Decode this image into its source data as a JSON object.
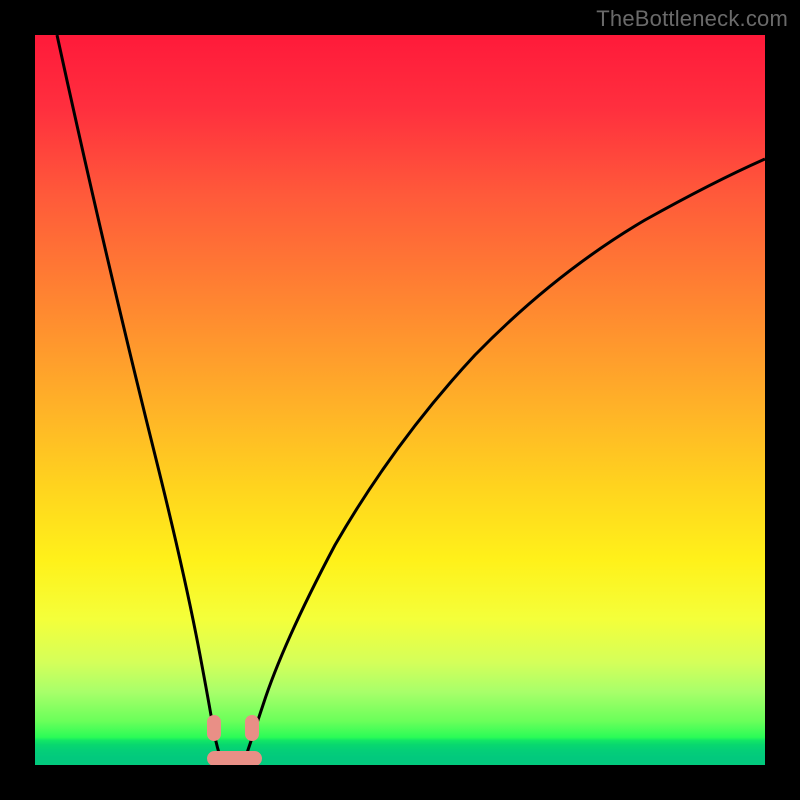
{
  "watermark": {
    "text": "TheBottleneck.com"
  },
  "chart_data": {
    "type": "line",
    "title": "",
    "xlabel": "",
    "ylabel": "",
    "xlim": [
      0,
      100
    ],
    "ylim": [
      0,
      100
    ],
    "grid": false,
    "legend": false,
    "series": [
      {
        "name": "curve",
        "x": [
          2,
          5,
          10,
          15,
          18,
          20,
          22,
          24,
          25,
          26,
          28,
          30,
          33,
          40,
          50,
          60,
          70,
          80,
          90,
          100
        ],
        "values": [
          100,
          82,
          55,
          30,
          15,
          6,
          1,
          0,
          0,
          0,
          1,
          4,
          10,
          25,
          42,
          55,
          65,
          73,
          79,
          84
        ]
      }
    ],
    "annotations": {
      "minimum_marker": {
        "x_range": [
          22,
          28
        ],
        "y": 0
      },
      "side_markers": [
        {
          "x": 21,
          "y": 4
        },
        {
          "x": 29,
          "y": 4
        }
      ]
    },
    "background_gradient": {
      "direction": "vertical",
      "stops": [
        {
          "pos": 0,
          "color": "#ff1a3a"
        },
        {
          "pos": 38,
          "color": "#ff8a30"
        },
        {
          "pos": 72,
          "color": "#fff11a"
        },
        {
          "pos": 92,
          "color": "#6aff5a"
        },
        {
          "pos": 100,
          "color": "#02c97d"
        }
      ]
    }
  }
}
